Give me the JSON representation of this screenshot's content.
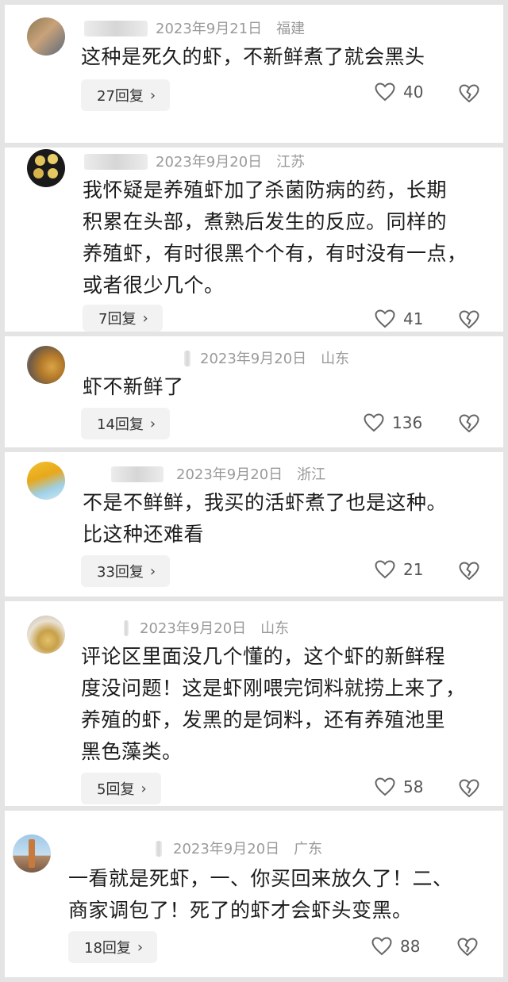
{
  "comments": [
    {
      "date": "2023年9月21日",
      "location": "福建",
      "lines": [
        "这种是死久的虾，不新鲜煮了就会黑头"
      ],
      "replies": "27回复",
      "likes": "40"
    },
    {
      "date": "2023年9月20日",
      "location": "江苏",
      "lines": [
        "我怀疑是养殖虾加了杀菌防病的药，长期",
        "积累在头部，煮熟后发生的反应。同样的",
        "养殖虾，有时很黑个个有，有时没有一点，",
        "或者很少几个。"
      ],
      "replies": "7回复",
      "likes": "41"
    },
    {
      "date": "2023年9月20日",
      "location": "山东",
      "lines": [
        "虾不新鲜了"
      ],
      "replies": "14回复",
      "likes": "136"
    },
    {
      "date": "2023年9月20日",
      "location": "浙江",
      "lines": [
        "不是不鲜鲜，我买的活虾煮了也是这种。",
        "比这种还难看"
      ],
      "replies": "33回复",
      "likes": "21"
    },
    {
      "date": "2023年9月20日",
      "location": "山东",
      "lines": [
        "评论区里面没几个懂的，这个虾的新鲜程",
        "度没问题！这是虾刚喂完饲料就捞上来了，",
        "养殖的虾，发黑的是饲料，还有养殖池里",
        "黑色藻类。"
      ],
      "replies": "5回复",
      "likes": "58"
    },
    {
      "date": "2023年9月20日",
      "location": "广东",
      "lines": [
        "一看就是死虾，一、你买回来放久了！二、",
        "商家调包了！死了的虾才会虾头变黑。"
      ],
      "replies": "18回复",
      "likes": "88"
    }
  ],
  "icons": {
    "like": "heart-outline-icon",
    "dislike": "broken-heart-icon",
    "chevron": "chevron-right-icon"
  },
  "colors": {
    "background": "#e4e4e4",
    "card": "#ffffff",
    "meta_text": "#9a9a9a",
    "reply_chip": "#f2f2f2"
  }
}
